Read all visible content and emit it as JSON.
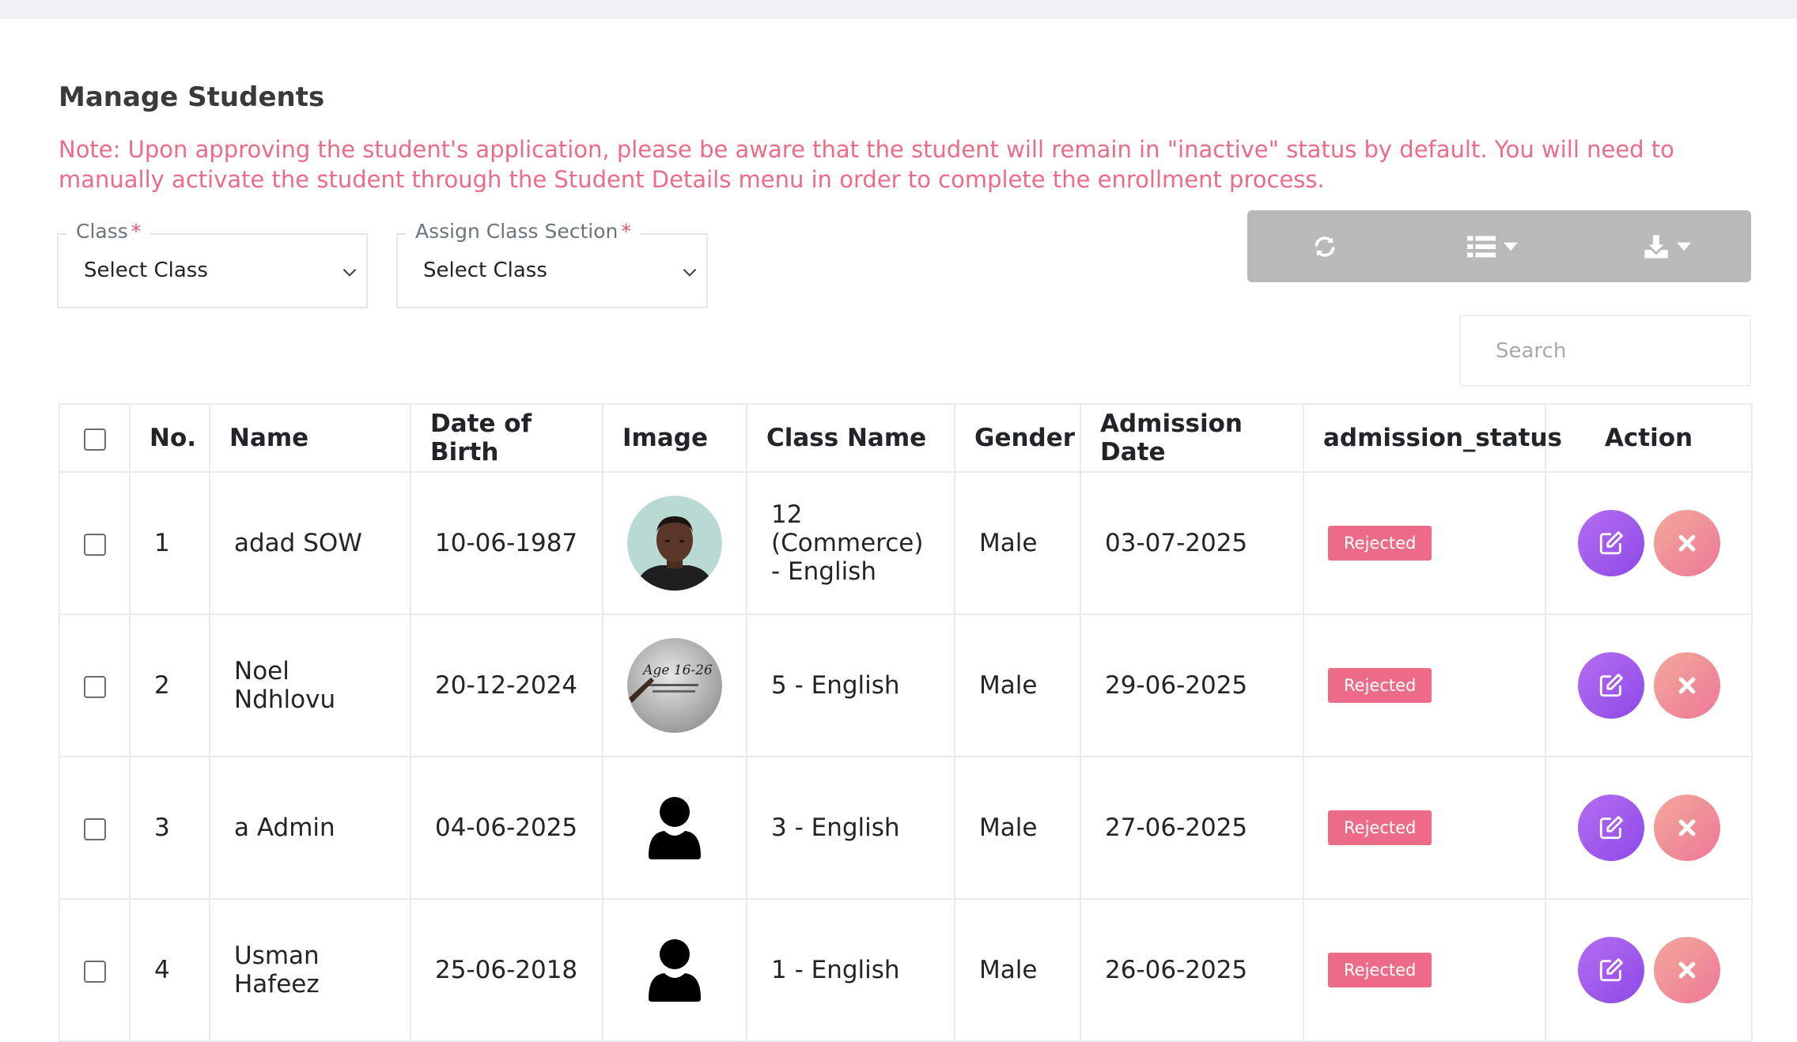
{
  "page": {
    "title": "Manage Students",
    "note": "Note: Upon approving the student's application, please be aware that the student will remain in \"inactive\" status by default. You will need to manually activate the student through the Student Details menu in order to complete the enrollment process."
  },
  "filters": {
    "class": {
      "label": "Class",
      "required_mark": "*",
      "value": "Select Class"
    },
    "section": {
      "label": "Assign Class Section",
      "required_mark": "*",
      "value": "Select Class"
    }
  },
  "toolbar": {
    "refresh_icon": "refresh-icon",
    "columns_icon": "list-icon",
    "export_icon": "download-icon"
  },
  "search": {
    "placeholder": "Search"
  },
  "table": {
    "headers": [
      "No.",
      "Name",
      "Date of Birth",
      "Image",
      "Class Name",
      "Gender",
      "Admission Date",
      "admission_status",
      "Action"
    ],
    "rows": [
      {
        "no": "1",
        "name": "adad SOW",
        "dob": "10-06-1987",
        "image": "photo-man",
        "class_name": "12 (Commerce) - English",
        "gender": "Male",
        "admission_date": "03-07-2025",
        "status": "Rejected"
      },
      {
        "no": "2",
        "name": "Noel Ndhlovu",
        "dob": "20-12-2024",
        "image": "photo-age",
        "image_text": "Age 16-26",
        "class_name": "5 - English",
        "gender": "Male",
        "admission_date": "29-06-2025",
        "status": "Rejected"
      },
      {
        "no": "3",
        "name": "a Admin",
        "dob": "04-06-2025",
        "image": "user-icon",
        "class_name": "3 - English",
        "gender": "Male",
        "admission_date": "27-06-2025",
        "status": "Rejected"
      },
      {
        "no": "4",
        "name": "Usman Hafeez",
        "dob": "25-06-2018",
        "image": "user-icon",
        "class_name": "1 - English",
        "gender": "Male",
        "admission_date": "26-06-2025",
        "status": "Rejected"
      }
    ]
  },
  "colors": {
    "note": "#ec6b86",
    "badge": "#ec6b86",
    "edit_button": "#9b59f0",
    "delete_button": "#f19a9a",
    "toolbar": "#bab8b9"
  }
}
